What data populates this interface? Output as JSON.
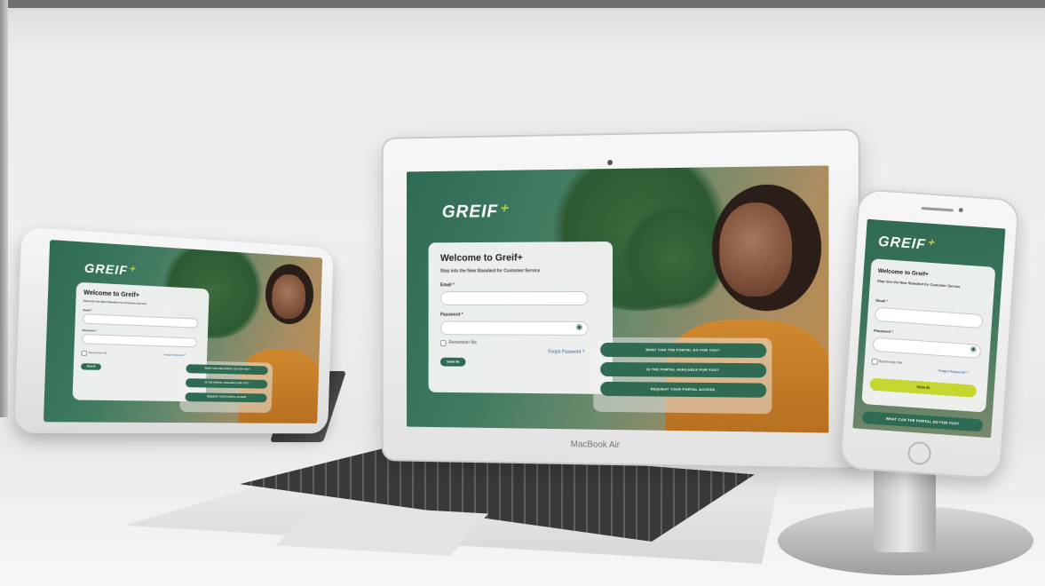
{
  "brand": {
    "logo": "GREIF",
    "accent": "#2f6a52",
    "lime": "#c6d630"
  },
  "login": {
    "title": "Welcome to Greif+",
    "subtitle": "Step into the New Standard for Customer Service",
    "email_label": "Email *",
    "password_label": "Password *",
    "remember": "Remember Me",
    "forgot": "Forgot Password ?",
    "signin": "SIGN IN"
  },
  "cta": {
    "portal_do": "WHAT CAN THE PORTAL DO FOR YOU?",
    "portal_available": "IS THE PORTAL AVAILABLE FOR YOU?",
    "request_access": "REQUEST YOUR PORTAL ACCESS"
  },
  "laptop": {
    "brand_label": "MacBook Air"
  },
  "icons": [
    "eye-icon",
    "camera-icon",
    "home-button-icon",
    "spark-icon"
  ]
}
